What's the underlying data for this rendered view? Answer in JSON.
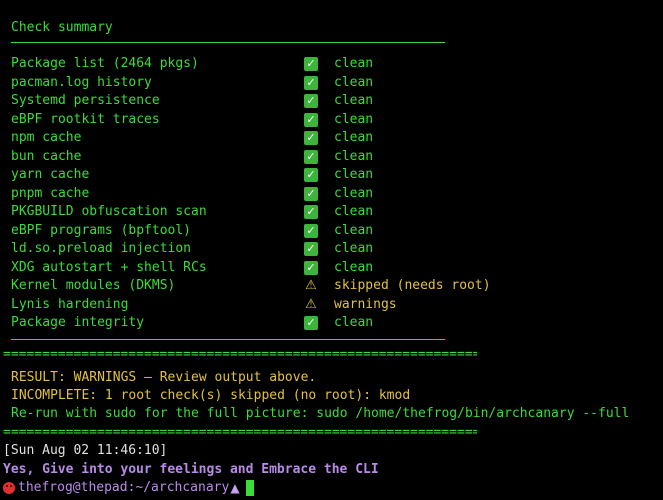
{
  "summary": {
    "title": "Check summary",
    "rows": [
      {
        "name": "Package list (2464 pkgs)",
        "icon": "check-mark-icon",
        "status": "clean",
        "state": "ok"
      },
      {
        "name": "pacman.log history",
        "icon": "check-mark-icon",
        "status": "clean",
        "state": "ok"
      },
      {
        "name": "Systemd persistence",
        "icon": "check-mark-icon",
        "status": "clean",
        "state": "ok"
      },
      {
        "name": "eBPF rootkit traces",
        "icon": "check-mark-icon",
        "status": "clean",
        "state": "ok"
      },
      {
        "name": "npm cache",
        "icon": "check-mark-icon",
        "status": "clean",
        "state": "ok"
      },
      {
        "name": "bun cache",
        "icon": "check-mark-icon",
        "status": "clean",
        "state": "ok"
      },
      {
        "name": "yarn cache",
        "icon": "check-mark-icon",
        "status": "clean",
        "state": "ok"
      },
      {
        "name": "pnpm cache",
        "icon": "check-mark-icon",
        "status": "clean",
        "state": "ok"
      },
      {
        "name": "PKGBUILD obfuscation scan",
        "icon": "check-mark-icon",
        "status": "clean",
        "state": "ok"
      },
      {
        "name": "eBPF programs (bpftool)",
        "icon": "check-mark-icon",
        "status": "clean",
        "state": "ok"
      },
      {
        "name": "ld.so.preload injection",
        "icon": "check-mark-icon",
        "status": "clean",
        "state": "ok"
      },
      {
        "name": "XDG autostart + shell RCs",
        "icon": "check-mark-icon",
        "status": "clean",
        "state": "ok"
      },
      {
        "name": "Kernel modules (DKMS)",
        "icon": "warning-icon",
        "status": "skipped (needs root)",
        "state": "warn"
      },
      {
        "name": "Lynis hardening",
        "icon": "warning-icon",
        "status": "warnings",
        "state": "warn"
      },
      {
        "name": "Package integrity",
        "icon": "check-mark-icon",
        "status": "clean",
        "state": "ok"
      }
    ]
  },
  "divider": "=======================================================================",
  "result": {
    "line1": "RESULT: WARNINGS — Review output above.",
    "line2": "INCOMPLETE: 1 root check(s) skipped (no root): kmod",
    "line3": "Re-run with sudo for the full picture: sudo /home/thefrog/bin/archcanary --full"
  },
  "timestamp": "[Sun Aug 02 11:46:10]",
  "motd": "Yes, Give into your feelings and Embrace the CLI",
  "prompt": {
    "text": "thefrog@thepad:~/archcanary",
    "face_icon": "red-face-icon",
    "suffix_icon": "pile-icon"
  },
  "colors": {
    "green": "#3adb3a",
    "yellow": "#e2c044",
    "purple": "#b88be8",
    "background": "#000000"
  }
}
